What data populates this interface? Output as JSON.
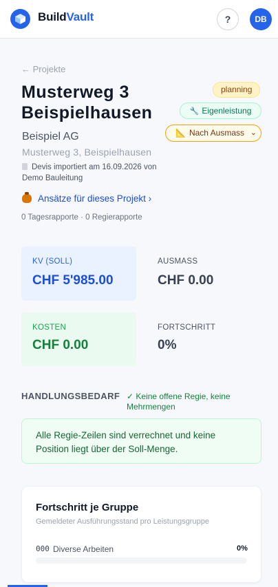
{
  "header": {
    "brand_part1": "Build",
    "brand_part2": "Vault",
    "help_label": "?",
    "avatar_initials": "DB"
  },
  "project": {
    "back_label": "← Projekte",
    "title": "Musterweg 3 Beispielhausen",
    "status_badge": "planning",
    "own_work_badge": "Eigenleistung",
    "billing_mode_select": "Nach Ausmass",
    "client": "Beispiel AG",
    "address": "Musterweg 3, Beispielhausen",
    "import_note": "Devis importiert am 16.09.2026 von Demo Bauleitung",
    "approaches_link": "Ansätze für dieses Projekt ›",
    "reports_summary": "0 Tagesrapporte · 0 Regierapporte"
  },
  "stats": {
    "kv": {
      "label": "KV (SOLL)",
      "value": "CHF 5'985.00"
    },
    "ausmass": {
      "label": "AUSMASS",
      "value": "CHF 0.00"
    },
    "kosten": {
      "label": "KOSTEN",
      "value": "CHF 0.00"
    },
    "fortschritt": {
      "label": "FORTSCHRITT",
      "value": "0%"
    }
  },
  "action_needed": {
    "heading": "HANDLUNGSBEDARF",
    "status": "✓ Keine offene Regie, keine Mehrmengen",
    "message": "Alle Regie-Zeilen sind verrechnet und keine Position liegt über der Soll-Menge."
  },
  "progress_card": {
    "title": "Fortschritt je Gruppe",
    "subtitle": "Gemeldeter Ausführungsstand pro Leistungsgruppe",
    "groups": [
      {
        "code": "000",
        "name": "Diverse Arbeiten",
        "percent_label": "0%",
        "fraction": 0
      }
    ]
  },
  "colors": {
    "accent": "#2563eb",
    "kv_value": "#1d4ed8",
    "cost_value": "#15803d",
    "status_badge_bg": "#fef3c7"
  },
  "icons": {
    "logo": "cube-icon",
    "own_work": "wrench-icon",
    "billing_mode": "ruler-triangle-icon",
    "import_note": "document-icon",
    "approaches": "money-bag-icon"
  }
}
